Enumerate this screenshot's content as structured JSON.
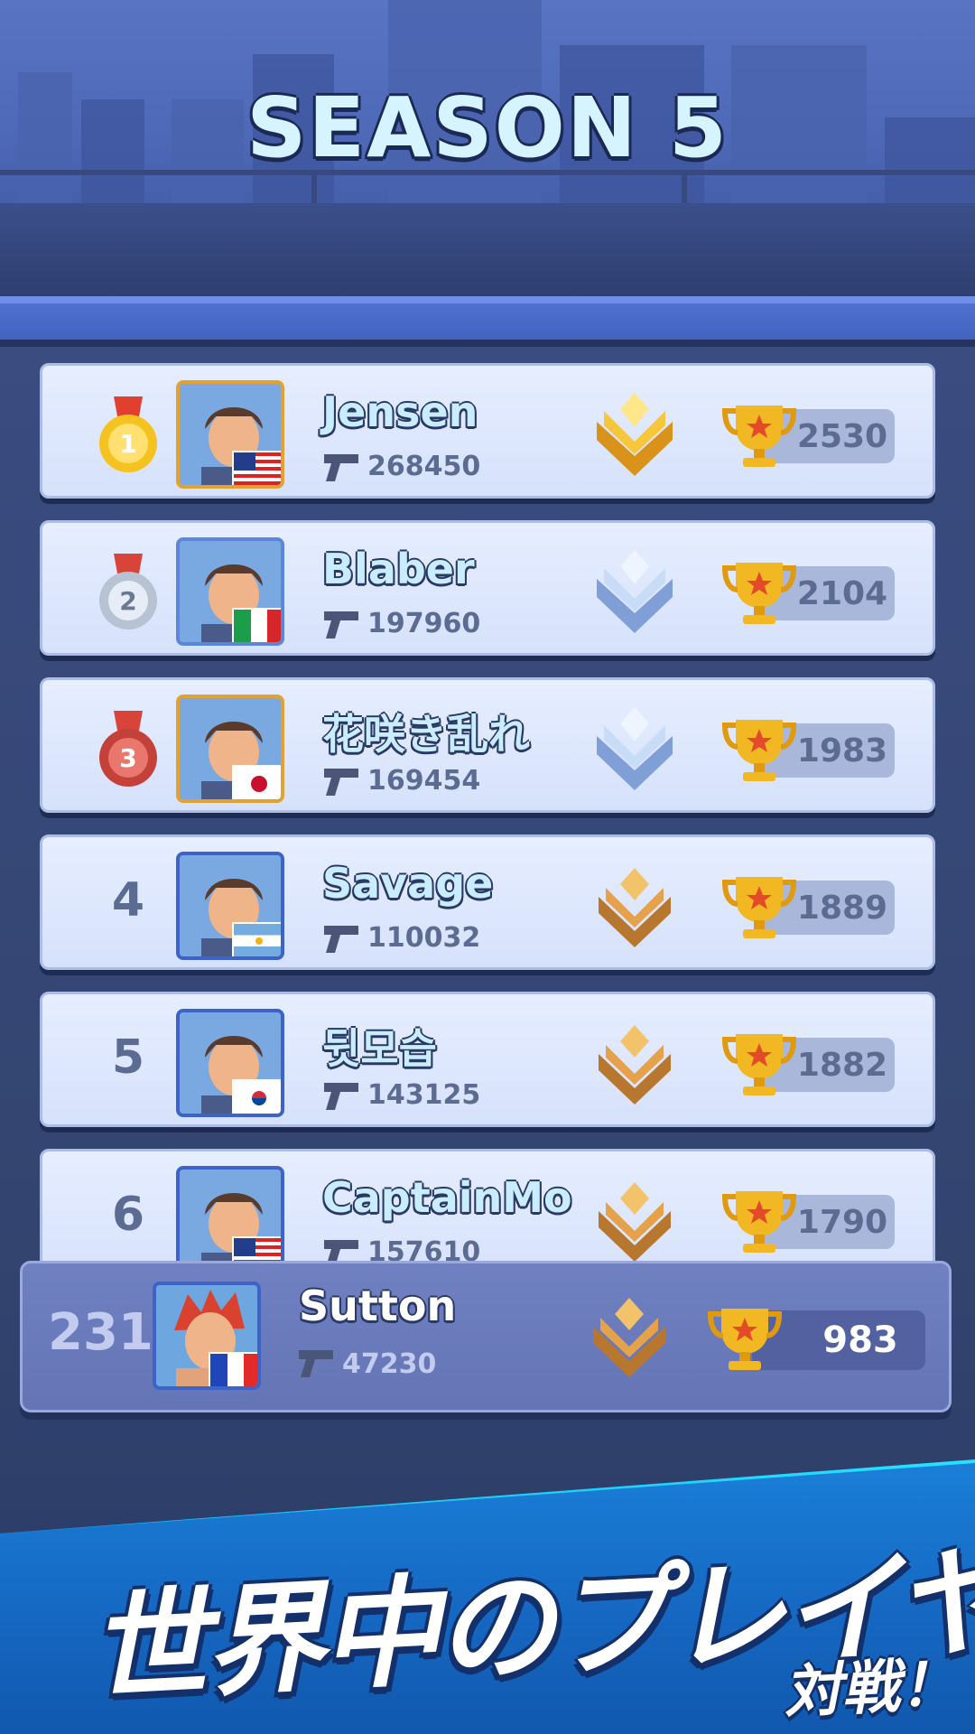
{
  "header": {
    "title": "SEASON 5"
  },
  "leaderboard": [
    {
      "rank": "1",
      "medal": "gold",
      "name": "Jensen",
      "score": "268450",
      "trophies": "2530",
      "flag": "usa",
      "rank_badge": "gold-crown-badge",
      "avatar_color": "#e2a231"
    },
    {
      "rank": "2",
      "medal": "silver",
      "name": "Blaber",
      "score": "197960",
      "trophies": "2104",
      "flag": "italy",
      "rank_badge": "diamond-badge",
      "avatar_color": "#5c86d8"
    },
    {
      "rank": "3",
      "medal": "bronze",
      "name": "花咲き乱れ",
      "score": "169454",
      "trophies": "1983",
      "flag": "japan",
      "rank_badge": "diamond-badge",
      "avatar_color": "#e2a231"
    },
    {
      "rank": "4",
      "medal": "",
      "name": "Savage",
      "score": "110032",
      "trophies": "1889",
      "flag": "argentina",
      "rank_badge": "bronze-badge",
      "avatar_color": "#3d63c8"
    },
    {
      "rank": "5",
      "medal": "",
      "name": "뒷모습",
      "score": "143125",
      "trophies": "1882",
      "flag": "korea",
      "rank_badge": "bronze-badge",
      "avatar_color": "#3d63c8"
    },
    {
      "rank": "6",
      "medal": "",
      "name": "CaptainMo",
      "score": "157610",
      "trophies": "1790",
      "flag": "usa",
      "rank_badge": "bronze-badge",
      "avatar_color": "#3d63c8"
    }
  ],
  "self": {
    "rank": "231",
    "name": "Sutton",
    "score": "47230",
    "trophies": "983",
    "flag": "france",
    "rank_badge": "bronze-badge"
  },
  "banner": {
    "slogan": "世界中のプレイヤー",
    "sub": "対戦！"
  },
  "colors": {
    "gold": "#f2b824",
    "silver": "#bcc7d6",
    "bronze": "#c9453a",
    "accent": "#27e3ff"
  }
}
